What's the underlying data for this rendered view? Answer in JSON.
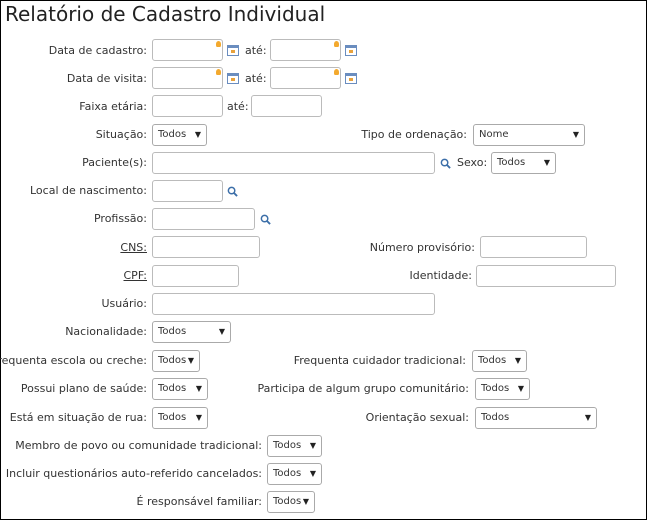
{
  "title": "Relatório de Cadastro Individual",
  "labels": {
    "data_cadastro": "Data de cadastro:",
    "data_visita": "Data de visita:",
    "faixa_etaria": "Faixa etária:",
    "ate": "até:",
    "situacao": "Situação:",
    "tipo_ordenacao": "Tipo de ordenação:",
    "paciente": "Paciente(s):",
    "sexo": "Sexo:",
    "local_nascimento": "Local de nascimento:",
    "profissao": "Profissão:",
    "cns": "CNS:",
    "numero_provisorio": "Número provisório:",
    "cpf": "CPF:",
    "identidade": "Identidade:",
    "usuario": "Usuário:",
    "nacionalidade": "Nacionalidade:",
    "frequenta_escola": "Frequenta escola ou creche:",
    "frequenta_cuidador": "Frequenta cuidador tradicional:",
    "plano_saude": "Possui plano de saúde:",
    "grupo_comunitario": "Participa de algum grupo comunitário:",
    "situacao_rua": "Está em situação de rua:",
    "orientacao_sexual": "Orientação sexual:",
    "membro_povo": "Membro de povo ou comunidade tradicional:",
    "questionarios": "Incluir questionários auto-referido cancelados:",
    "responsavel_familiar": "É responsável familiar:"
  },
  "selects": {
    "situacao": "Todos",
    "tipo_ordenacao": "Nome",
    "sexo": "Todos",
    "nacionalidade": "Todos",
    "frequenta_escola": "Todos",
    "frequenta_cuidador": "Todos",
    "plano_saude": "Todos",
    "grupo_comunitario": "Todos",
    "situacao_rua": "Todos",
    "orientacao_sexual": "Todos",
    "membro_povo": "Todos",
    "questionarios": "Todos",
    "responsavel_familiar": "Todos"
  },
  "icons": {
    "calendar": "calendar-icon",
    "search": "search-icon",
    "hint": "lightbulb-icon",
    "dropdown": "chevron-down-icon"
  },
  "colors": {
    "calendar_accent": "#6a8dbf",
    "hint": "#f3a92e",
    "search": "#3b6ea8"
  }
}
